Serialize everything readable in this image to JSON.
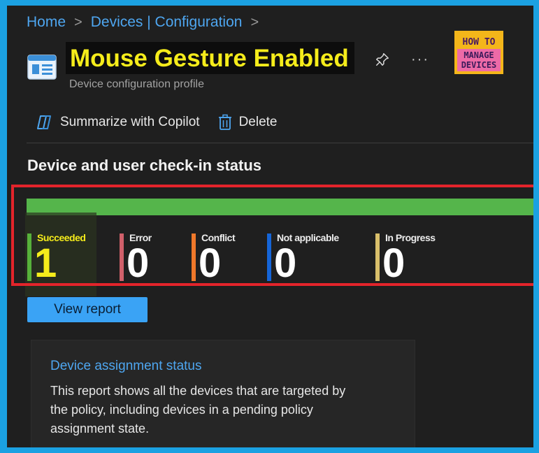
{
  "breadcrumb": {
    "home": "Home",
    "devices": "Devices | Configuration",
    "separator": ">"
  },
  "header": {
    "title": "Mouse Gesture Enabled",
    "subtitle": "Device configuration profile",
    "more": "···",
    "logo": {
      "line1": "HOW TO",
      "line2": "MANAGE",
      "line3": "DEVICES"
    }
  },
  "toolbar": {
    "summarize_label": "Summarize with Copilot",
    "delete_label": "Delete"
  },
  "status": {
    "section_title": "Device and user check-in status",
    "items": [
      {
        "label": "Succeeded",
        "value": "1",
        "color": "#57b13b",
        "label_color": "#f5ec1b",
        "value_color": "#f5ec1b"
      },
      {
        "label": "Error",
        "value": "0",
        "color": "#d0606a"
      },
      {
        "label": "Conflict",
        "value": "0",
        "color": "#f0782a"
      },
      {
        "label": "Not applicable",
        "value": "0",
        "color": "#1565d8"
      },
      {
        "label": "In Progress",
        "value": "0",
        "color": "#d9bf6a"
      }
    ],
    "view_report": "View report"
  },
  "assignment": {
    "title": "Device assignment status",
    "description": "This report shows all the devices that are targeted by the policy, including devices in a pending policy assignment state."
  }
}
